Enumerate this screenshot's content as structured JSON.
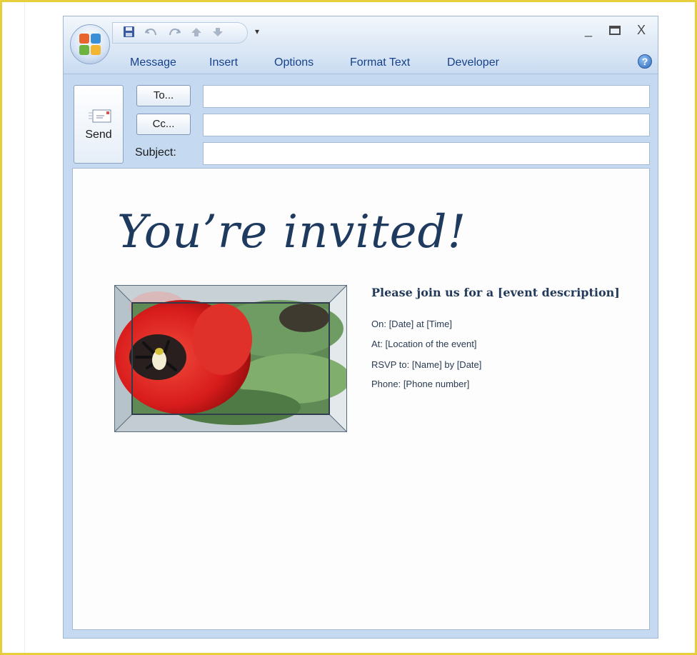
{
  "quick_access": {
    "save_icon": "save-icon",
    "undo_icon": "undo-icon",
    "redo_icon": "redo-icon",
    "up_icon": "arrow-up-icon",
    "down_icon": "arrow-down-icon",
    "customize_glyph": "▾"
  },
  "window_controls": {
    "minimize": "_",
    "maximize": "▭",
    "close": "X"
  },
  "ribbon": {
    "tabs": [
      {
        "label": "Message"
      },
      {
        "label": "Insert"
      },
      {
        "label": "Options"
      },
      {
        "label": "Format Text"
      },
      {
        "label": "Developer"
      }
    ],
    "help_glyph": "?"
  },
  "header": {
    "send_label": "Send",
    "to_label": "To...",
    "cc_label": "Cc...",
    "subject_label": "Subject:",
    "to_value": "",
    "cc_value": "",
    "subject_value": ""
  },
  "body": {
    "headline": "You’re invited!",
    "event_title": "Please join us for a [event description]",
    "details": [
      {
        "text": "On:   [Date] at [Time]"
      },
      {
        "text": "At:  [Location of the event]"
      },
      {
        "text": "RSVP to:  [Name] by [Date]"
      },
      {
        "text": "Phone:  [Phone number]"
      }
    ]
  },
  "colors": {
    "page_border": "#e6cf3a",
    "ribbon_text": "#15428b",
    "headline": "#1e3a5f",
    "window_chrome": "#c5d9f1"
  }
}
